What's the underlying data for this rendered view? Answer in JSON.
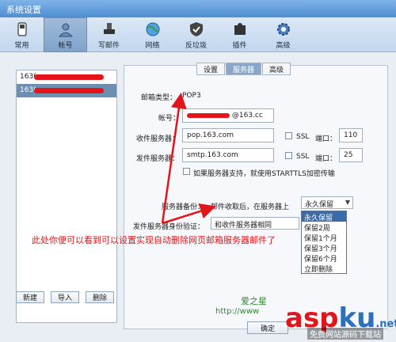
{
  "window": {
    "title": "系统设置"
  },
  "toolbar": [
    {
      "label": "常用",
      "icon": "phone-icon"
    },
    {
      "label": "帐号",
      "icon": "user-icon",
      "selected": true
    },
    {
      "label": "写邮件",
      "icon": "stamp-icon"
    },
    {
      "label": "网络",
      "icon": "globe-icon"
    },
    {
      "label": "反垃圾",
      "icon": "shield-icon"
    },
    {
      "label": "插件",
      "icon": "puzzle-icon"
    },
    {
      "label": "高级",
      "icon": "gear-icon"
    }
  ],
  "accounts": [
    {
      "prefix": "163("
    },
    {
      "prefix": "163(",
      "selected": true
    }
  ],
  "account_buttons": {
    "new": "新建",
    "import": "导入",
    "delete": "删除"
  },
  "tabs": [
    {
      "label": "设置"
    },
    {
      "label": "服务器",
      "selected": true
    },
    {
      "label": "高级"
    }
  ],
  "server": {
    "type_label": "邮箱类型：",
    "type_value": "POP3",
    "account_label": "帐号：",
    "account_value": "@163.cc",
    "incoming_label": "收件服务器：",
    "incoming_value": "pop.163.com",
    "outgoing_label": "发件服务器：",
    "outgoing_value": "smtp.163.com",
    "ssl_label": "SSL",
    "port_label": "端口：",
    "incoming_port": "110",
    "outgoing_port": "25",
    "starttls_label": "如果服务器支持，就使用STARTTLS加密传输",
    "backup_label": "服务器备份：",
    "backup_desc": "邮件收取后，在服务器上",
    "backup_selected": "永久保留",
    "backup_options": [
      "永久保留",
      "保留2周",
      "保留1个月",
      "保留3个月",
      "保留6个月",
      "立即删除"
    ],
    "auth_label": "发件服务器身份验证：",
    "auth_value": "和收件服务器相同"
  },
  "annotation": "此处你便可以看到可以设置实现自动删除网页邮箱服务器邮件了",
  "watermark": {
    "site_cn": "爱之星",
    "site_url": "http://www",
    "brand_a": "asp",
    "brand_b": "ku",
    "brand_c": ".net",
    "caption": "免费网站源码下载站"
  },
  "footer": {
    "ok_label": "确定"
  },
  "colors": {
    "annotation": "#e2151a",
    "accent": "#4e8ed3"
  }
}
